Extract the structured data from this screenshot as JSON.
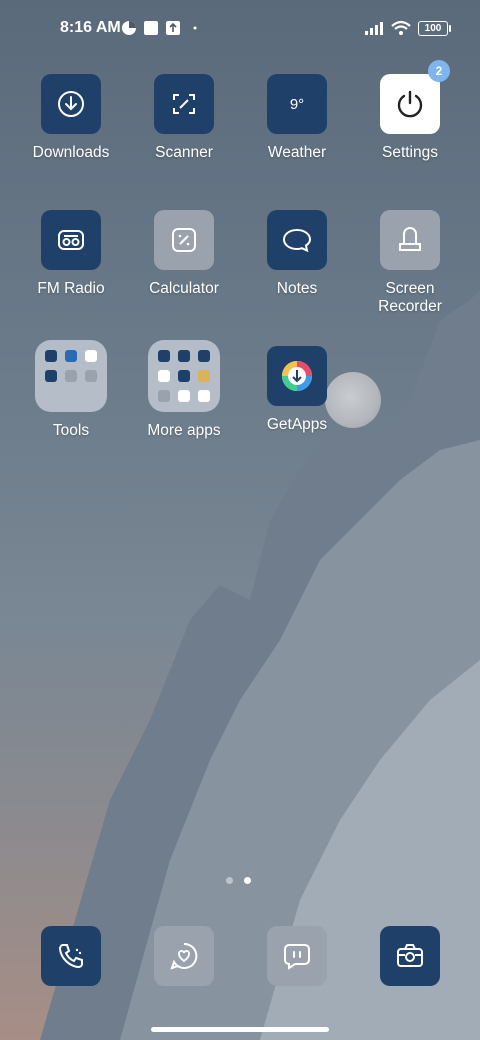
{
  "status_bar": {
    "time": "8:16 AM",
    "battery": "100"
  },
  "apps": {
    "downloads": "Downloads",
    "scanner": "Scanner",
    "weather": "Weather",
    "weather_temp": "9°",
    "settings": "Settings",
    "settings_badge": "2",
    "fm_radio": "FM Radio",
    "calculator": "Calculator",
    "notes": "Notes",
    "screen_recorder_line1": "Screen",
    "screen_recorder_line2": "Recorder",
    "tools": "Tools",
    "more_apps": "More apps",
    "getapps": "GetApps"
  },
  "page_indicator": {
    "pages": 2,
    "active": 2
  },
  "colors": {
    "icon_dark": "#1f4068",
    "icon_light": "#9aa3ad",
    "badge": "#7fb5ee"
  }
}
